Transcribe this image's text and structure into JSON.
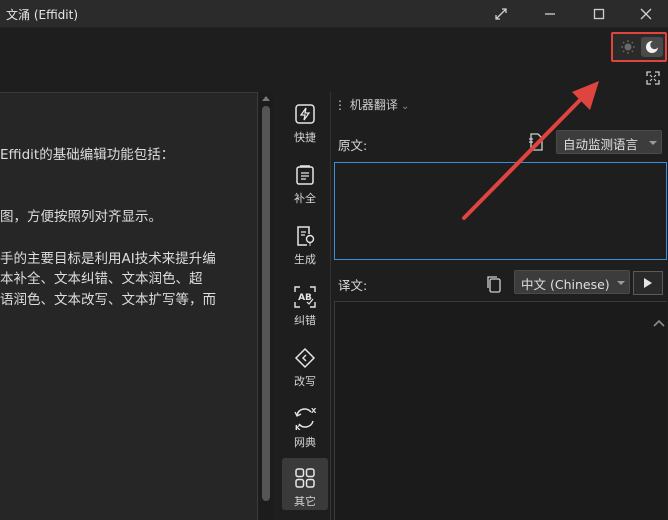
{
  "window": {
    "title": "文涌 (Effidit)",
    "controls": [
      "restore-size",
      "minimize",
      "maximize",
      "close"
    ]
  },
  "theme_switch": {
    "options": [
      "light",
      "dark"
    ],
    "selected": "dark",
    "highlight_color": "#e0443f"
  },
  "editor": {
    "lines": [
      "Effidit的基础编辑功能包括：",
      "图，方便按照列对齐显示。",
      "手的主要目标是利用AI技术来提升编",
      "本补全、文本纠错、文本润色、超",
      "语润色、文本改写、文本扩写等，而"
    ]
  },
  "rail": {
    "items": [
      {
        "label": "快捷",
        "icon": "lightning-icon"
      },
      {
        "label": "补全",
        "icon": "document-stack-icon"
      },
      {
        "label": "生成",
        "icon": "document-bulb-icon"
      },
      {
        "label": "纠错",
        "icon": "ab-correct-icon"
      },
      {
        "label": "改写",
        "icon": "diamond-tag-icon"
      },
      {
        "label": "网典",
        "icon": "refresh-xk-icon"
      },
      {
        "label": "其它",
        "icon": "grid-icon"
      }
    ],
    "active_index": 6
  },
  "translate": {
    "header": "机器翻译",
    "source_label": "原文:",
    "source_language": "自动监测语言",
    "source_text": "",
    "target_label": "译文:",
    "target_language": "中文 (Chinese)",
    "result_text": ""
  },
  "colors": {
    "accent_blue": "#3d8ed8",
    "annotation_red": "#e0443f"
  }
}
